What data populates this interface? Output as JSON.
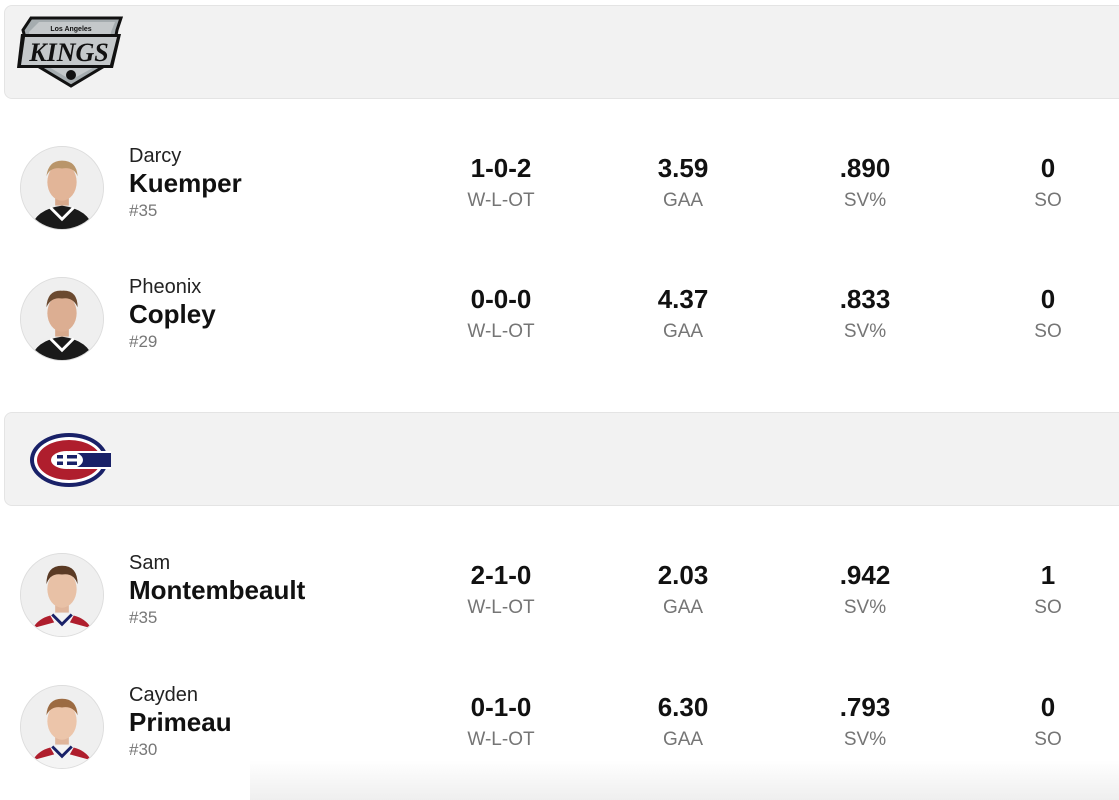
{
  "teams": [
    {
      "logo_icon": "la-kings-logo",
      "logo_text": {
        "city": "Los Angeles",
        "name": "KINGS"
      },
      "goalies": [
        {
          "first": "Darcy",
          "last": "Kuemper",
          "number": "#35",
          "record": "1-0-2",
          "gaa": "3.59",
          "sv": ".890",
          "so": "0",
          "jersey_color": "#1a1a1a"
        },
        {
          "first": "Pheonix",
          "last": "Copley",
          "number": "#29",
          "record": "0-0-0",
          "gaa": "4.37",
          "sv": ".833",
          "so": "0",
          "jersey_color": "#1a1a1a"
        }
      ]
    },
    {
      "logo_icon": "montreal-canadiens-logo",
      "goalies": [
        {
          "first": "Sam",
          "last": "Montembeault",
          "number": "#35",
          "record": "2-1-0",
          "gaa": "2.03",
          "sv": ".942",
          "so": "1",
          "jersey_color": "#ffffff"
        },
        {
          "first": "Cayden",
          "last": "Primeau",
          "number": "#30",
          "record": "0-1-0",
          "gaa": "6.30",
          "sv": ".793",
          "so": "0",
          "jersey_color": "#ffffff"
        }
      ]
    }
  ],
  "labels": {
    "record": "W-L-OT",
    "gaa": "GAA",
    "sv": "SV%",
    "so": "SO"
  },
  "colors": {
    "header_bg": "#f2f2f2",
    "label": "#757575",
    "habs_red": "#af1e2d",
    "habs_blue": "#192168"
  }
}
